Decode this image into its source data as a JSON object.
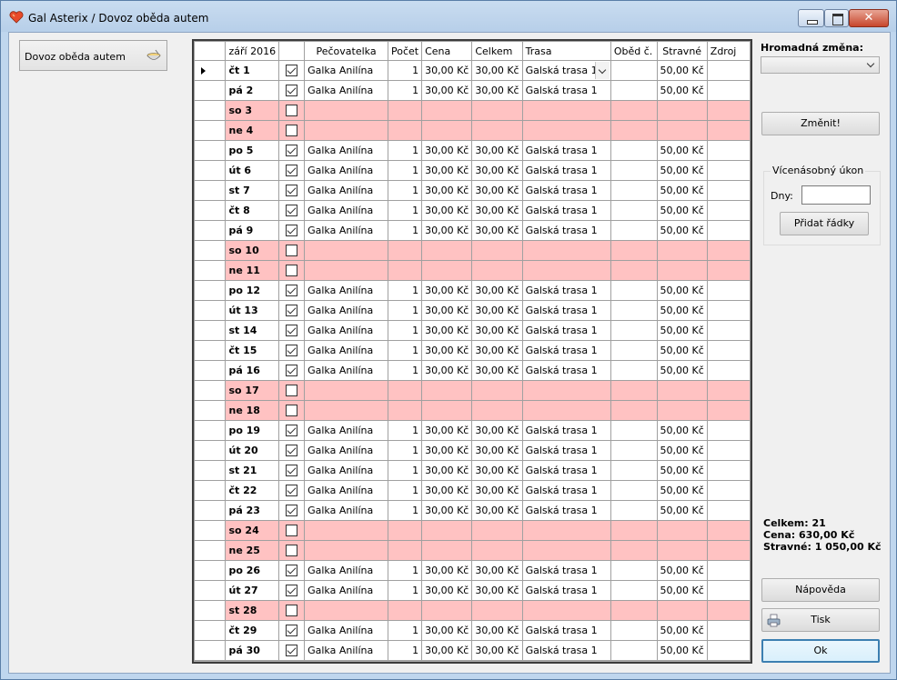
{
  "window": {
    "title": "Gal Asterix / Dovoz oběda autem"
  },
  "nav": {
    "item_label": "Dovoz oběda autem",
    "icon": "bowl-icon"
  },
  "grid": {
    "columns": [
      "září 2016",
      "",
      "Pečovatelka",
      "Počet",
      "Cena",
      "Celkem",
      "Trasa",
      "Oběd č.",
      "Stravné",
      "Zdroj"
    ],
    "rows": [
      {
        "day": "čt 1",
        "checked": true,
        "worker": "Galka Anilína",
        "count": "1",
        "price": "30,00 Kč",
        "total": "30,00 Kč",
        "route": "Galská trasa 1",
        "meal": "",
        "allowance": "50,00 Kč",
        "source": ""
      },
      {
        "day": "pá 2",
        "checked": true,
        "worker": "Galka Anilína",
        "count": "1",
        "price": "30,00 Kč",
        "total": "30,00 Kč",
        "route": "Galská trasa 1",
        "meal": "",
        "allowance": "50,00 Kč",
        "source": ""
      },
      {
        "day": "so 3",
        "checked": false,
        "weekend": true
      },
      {
        "day": "ne 4",
        "checked": false,
        "weekend": true
      },
      {
        "day": "po 5",
        "checked": true,
        "worker": "Galka Anilína",
        "count": "1",
        "price": "30,00 Kč",
        "total": "30,00 Kč",
        "route": "Galská trasa 1",
        "meal": "",
        "allowance": "50,00 Kč",
        "source": ""
      },
      {
        "day": "út 6",
        "checked": true,
        "worker": "Galka Anilína",
        "count": "1",
        "price": "30,00 Kč",
        "total": "30,00 Kč",
        "route": "Galská trasa 1",
        "meal": "",
        "allowance": "50,00 Kč",
        "source": ""
      },
      {
        "day": "st 7",
        "checked": true,
        "worker": "Galka Anilína",
        "count": "1",
        "price": "30,00 Kč",
        "total": "30,00 Kč",
        "route": "Galská trasa 1",
        "meal": "",
        "allowance": "50,00 Kč",
        "source": ""
      },
      {
        "day": "čt 8",
        "checked": true,
        "worker": "Galka Anilína",
        "count": "1",
        "price": "30,00 Kč",
        "total": "30,00 Kč",
        "route": "Galská trasa 1",
        "meal": "",
        "allowance": "50,00 Kč",
        "source": ""
      },
      {
        "day": "pá 9",
        "checked": true,
        "worker": "Galka Anilína",
        "count": "1",
        "price": "30,00 Kč",
        "total": "30,00 Kč",
        "route": "Galská trasa 1",
        "meal": "",
        "allowance": "50,00 Kč",
        "source": ""
      },
      {
        "day": "so 10",
        "checked": false,
        "weekend": true
      },
      {
        "day": "ne 11",
        "checked": false,
        "weekend": true
      },
      {
        "day": "po 12",
        "checked": true,
        "worker": "Galka Anilína",
        "count": "1",
        "price": "30,00 Kč",
        "total": "30,00 Kč",
        "route": "Galská trasa 1",
        "meal": "",
        "allowance": "50,00 Kč",
        "source": ""
      },
      {
        "day": "út 13",
        "checked": true,
        "worker": "Galka Anilína",
        "count": "1",
        "price": "30,00 Kč",
        "total": "30,00 Kč",
        "route": "Galská trasa 1",
        "meal": "",
        "allowance": "50,00 Kč",
        "source": ""
      },
      {
        "day": "st 14",
        "checked": true,
        "worker": "Galka Anilína",
        "count": "1",
        "price": "30,00 Kč",
        "total": "30,00 Kč",
        "route": "Galská trasa 1",
        "meal": "",
        "allowance": "50,00 Kč",
        "source": ""
      },
      {
        "day": "čt 15",
        "checked": true,
        "worker": "Galka Anilína",
        "count": "1",
        "price": "30,00 Kč",
        "total": "30,00 Kč",
        "route": "Galská trasa 1",
        "meal": "",
        "allowance": "50,00 Kč",
        "source": ""
      },
      {
        "day": "pá 16",
        "checked": true,
        "worker": "Galka Anilína",
        "count": "1",
        "price": "30,00 Kč",
        "total": "30,00 Kč",
        "route": "Galská trasa 1",
        "meal": "",
        "allowance": "50,00 Kč",
        "source": ""
      },
      {
        "day": "so 17",
        "checked": false,
        "weekend": true
      },
      {
        "day": "ne 18",
        "checked": false,
        "weekend": true
      },
      {
        "day": "po 19",
        "checked": true,
        "worker": "Galka Anilína",
        "count": "1",
        "price": "30,00 Kč",
        "total": "30,00 Kč",
        "route": "Galská trasa 1",
        "meal": "",
        "allowance": "50,00 Kč",
        "source": ""
      },
      {
        "day": "út 20",
        "checked": true,
        "worker": "Galka Anilína",
        "count": "1",
        "price": "30,00 Kč",
        "total": "30,00 Kč",
        "route": "Galská trasa 1",
        "meal": "",
        "allowance": "50,00 Kč",
        "source": ""
      },
      {
        "day": "st 21",
        "checked": true,
        "worker": "Galka Anilína",
        "count": "1",
        "price": "30,00 Kč",
        "total": "30,00 Kč",
        "route": "Galská trasa 1",
        "meal": "",
        "allowance": "50,00 Kč",
        "source": ""
      },
      {
        "day": "čt 22",
        "checked": true,
        "worker": "Galka Anilína",
        "count": "1",
        "price": "30,00 Kč",
        "total": "30,00 Kč",
        "route": "Galská trasa 1",
        "meal": "",
        "allowance": "50,00 Kč",
        "source": ""
      },
      {
        "day": "pá 23",
        "checked": true,
        "worker": "Galka Anilína",
        "count": "1",
        "price": "30,00 Kč",
        "total": "30,00 Kč",
        "route": "Galská trasa 1",
        "meal": "",
        "allowance": "50,00 Kč",
        "source": ""
      },
      {
        "day": "so 24",
        "checked": false,
        "weekend": true
      },
      {
        "day": "ne 25",
        "checked": false,
        "weekend": true
      },
      {
        "day": "po 26",
        "checked": true,
        "worker": "Galka Anilína",
        "count": "1",
        "price": "30,00 Kč",
        "total": "30,00 Kč",
        "route": "Galská trasa 1",
        "meal": "",
        "allowance": "50,00 Kč",
        "source": ""
      },
      {
        "day": "út 27",
        "checked": true,
        "worker": "Galka Anilína",
        "count": "1",
        "price": "30,00 Kč",
        "total": "30,00 Kč",
        "route": "Galská trasa 1",
        "meal": "",
        "allowance": "50,00 Kč",
        "source": ""
      },
      {
        "day": "st 28",
        "checked": false,
        "weekend": true
      },
      {
        "day": "čt 29",
        "checked": true,
        "worker": "Galka Anilína",
        "count": "1",
        "price": "30,00 Kč",
        "total": "30,00 Kč",
        "route": "Galská trasa 1",
        "meal": "",
        "allowance": "50,00 Kč",
        "source": ""
      },
      {
        "day": "pá 30",
        "checked": true,
        "worker": "Galka Anilína",
        "count": "1",
        "price": "30,00 Kč",
        "total": "30,00 Kč",
        "route": "Galská trasa 1",
        "meal": "",
        "allowance": "50,00 Kč",
        "source": ""
      }
    ],
    "current_row": 0,
    "weekend_color": "#ffc2c2"
  },
  "right_panel": {
    "bulk_label": "Hromadná změna:",
    "bulk_value": "",
    "change_button": "Změnit!",
    "multi_group_label": "Vícenásobný úkon",
    "days_label": "Dny:",
    "days_value": "",
    "add_rows_button": "Přidat řádky",
    "summary": {
      "total": "Celkem: 21",
      "price": "Cena: 630,00 Kč",
      "allowance": "Stravné: 1 050,00 Kč"
    },
    "help_button": "Nápověda",
    "print_button": "Tisk",
    "print_icon": "printer-icon",
    "ok_button": "Ok"
  },
  "colors": {
    "titlebar": "#bfd6ee",
    "close_button": "#c7452b",
    "ok_border": "#3c7fb1"
  }
}
